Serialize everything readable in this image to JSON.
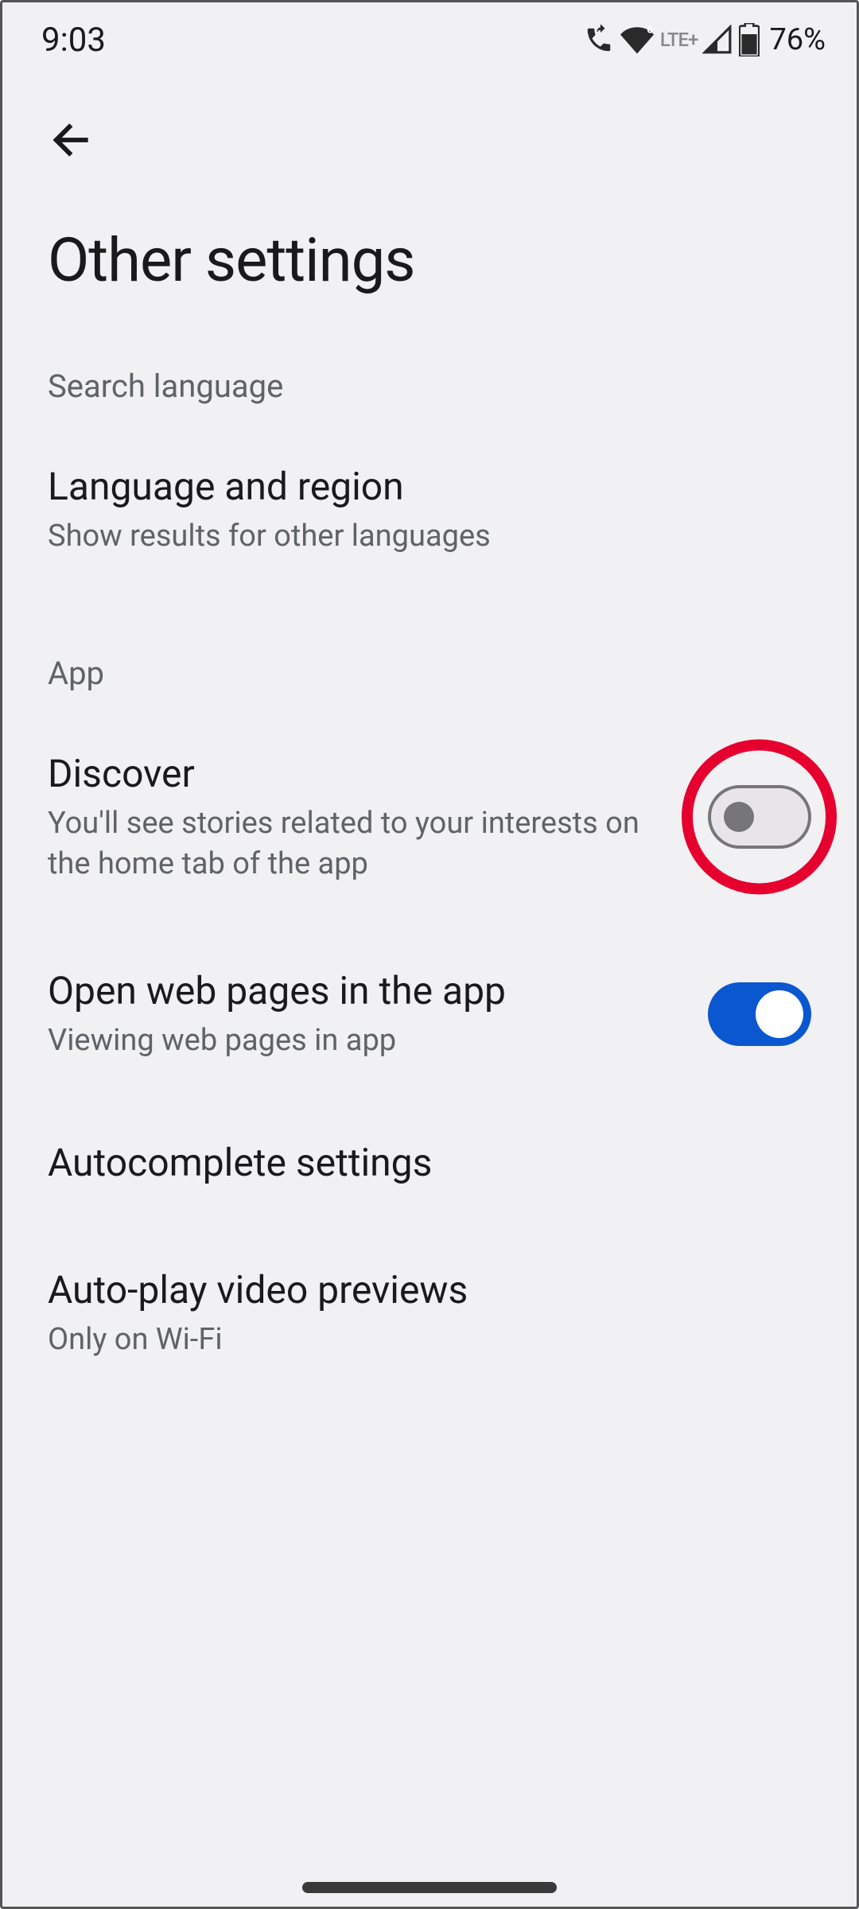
{
  "status_bar": {
    "time": "9:03",
    "battery": "76%",
    "lte": "LTE+"
  },
  "page": {
    "title": "Other settings"
  },
  "sections": {
    "search_language": {
      "header": "Search language",
      "language_region": {
        "title": "Language and region",
        "subtitle": "Show results for other languages"
      }
    },
    "app": {
      "header": "App",
      "discover": {
        "title": "Discover",
        "subtitle": "You'll see stories related to your interests on the home tab of the app",
        "enabled": false
      },
      "open_web_pages": {
        "title": "Open web pages in the app",
        "subtitle": "Viewing web pages in app",
        "enabled": true
      },
      "autocomplete": {
        "title": "Autocomplete settings"
      },
      "autoplay": {
        "title": "Auto-play video previews",
        "subtitle": "Only on Wi-Fi"
      }
    }
  },
  "annotation": {
    "highlight_target": "discover-toggle"
  }
}
